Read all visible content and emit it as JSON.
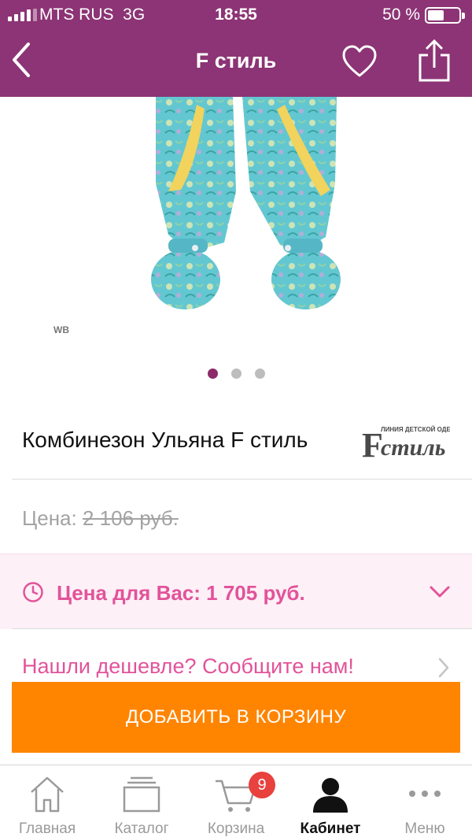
{
  "status_bar": {
    "carrier": "MTS RUS",
    "network": "3G",
    "time": "18:55",
    "battery": "50 %",
    "battery_level": 0.5
  },
  "nav": {
    "title": "F стиль",
    "back_icon": "chevron-left-icon",
    "favorite_icon": "heart-icon",
    "share_icon": "share-icon"
  },
  "gallery": {
    "watermark": "WB",
    "pages": 3,
    "current_page": 1
  },
  "product": {
    "title": "Комбинезон Ульяна F стиль",
    "brand_logo_caption": "ЛИНИЯ ДЕТСКОЙ ОДЕЖДЫ",
    "brand_logo_wordmark": "стиль",
    "old_price_label": "Цена:",
    "old_price": "2 106 руб.",
    "your_price": "Цена для Вас: 1 705 руб.",
    "cheaper_link": "Нашли дешевле? Сообщите нам!",
    "add_to_cart": "ДОБАВИТЬ В КОРЗИНУ"
  },
  "tabbar": {
    "items": [
      {
        "label": "Главная",
        "icon": "home-icon"
      },
      {
        "label": "Каталог",
        "icon": "catalog-icon"
      },
      {
        "label": "Корзина",
        "icon": "cart-icon",
        "badge": "9"
      },
      {
        "label": "Кабинет",
        "icon": "user-icon",
        "active": true
      },
      {
        "label": "Меню",
        "icon": "more-icon"
      }
    ]
  },
  "colors": {
    "brand_purple": "#8c3475",
    "accent_pink": "#e2539a",
    "cta_orange": "#ff8400",
    "badge_red": "#e8413e"
  }
}
